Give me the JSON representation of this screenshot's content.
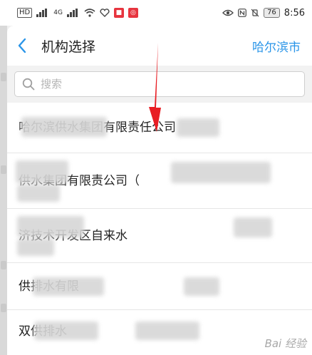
{
  "status_bar": {
    "left_chip": "HD",
    "signal_text": "4G",
    "battery": "76",
    "time": "8:56",
    "accent_red": "#e7353f"
  },
  "header": {
    "title": "机构选择",
    "city": "哈尔滨市",
    "accent": "#2a95e8"
  },
  "search": {
    "placeholder": "搜索",
    "value": ""
  },
  "org_list": [
    "哈尔滨供水集团有限责任公司",
    "供水集团有限责公司（",
    "济技术开发区自来水",
    "供排水有限",
    "双供排水"
  ],
  "watermark": "Bai 经验"
}
